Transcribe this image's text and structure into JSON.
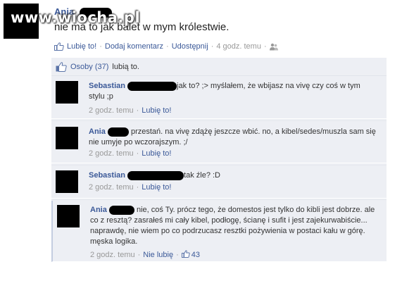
{
  "watermark": "www.wiocha.pl",
  "post": {
    "author": "Ania",
    "body": "nie ma to jak balet w mym królestwie.",
    "actions": {
      "like": "Lubię to!",
      "comment": "Dodaj komentarz",
      "share": "Udostępnij",
      "time": "4 godz. temu"
    }
  },
  "likes": {
    "people": "Osoby (37)",
    "suffix": "lubią to."
  },
  "comments": [
    {
      "author": "Sebastian",
      "text": "jak to? ;> myślałem, że wbijasz na vivę czy coś w tym stylu ;p",
      "time": "2 godz. temu",
      "action": "Lubię to!"
    },
    {
      "author": "Ania",
      "text": "przestań. na vivę zdążę jeszcze wbić. no, a kibel/sedes/muszla sam się nie umyje po wczorajszym. ;/",
      "time": "2 godz. temu",
      "action": "Lubię to!"
    },
    {
      "author": "Sebastian",
      "text": "tak źle? :D",
      "time": "2 godz. temu",
      "action": "Lubię to!"
    },
    {
      "author": "Ania",
      "text": "nie, coś Ty. prócz tego, że domestos jest tylko do kibli jest dobrze. ale co z resztą? zasrałeś mi cały kibel, podłogę, ścianę i sufit i jest zajekurwabiście... naprawdę, nie wiem po co podrzucasz resztki pożywienia w postaci kału w górę. męska logika.",
      "time": "2 godz. temu",
      "action": "Nie lubię",
      "like_count": "43"
    }
  ],
  "separator": "·",
  "icons": [
    "like-icon",
    "thumbs-up-icon",
    "people-icon"
  ]
}
